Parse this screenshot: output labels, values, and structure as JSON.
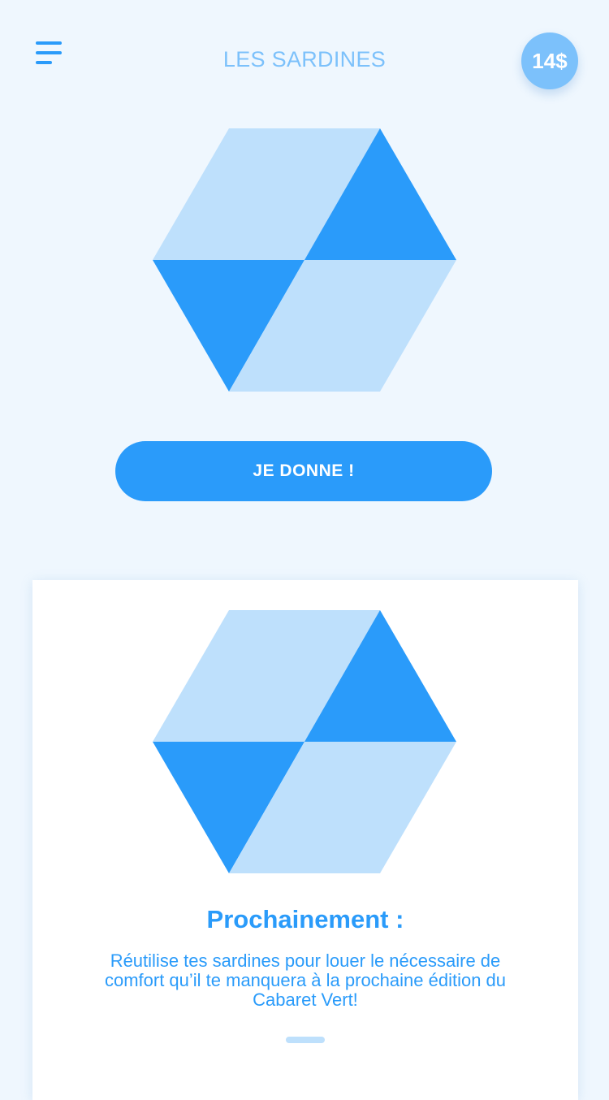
{
  "header": {
    "title": "LES SARDINES",
    "balance": "14$",
    "menu_icon": "hamburger-menu-icon"
  },
  "hero": {
    "logo_icon": "hexagon-cube-logo-icon",
    "cta_label": "JE DONNE !"
  },
  "card": {
    "logo_icon": "hexagon-cube-logo-icon",
    "title": "Prochainement :",
    "description": "Réutilise tes sardines pour louer le nécessaire de comfort qu’il te manquera à la prochaine édition du Cabaret Vert!"
  },
  "colors": {
    "background": "#EFF7FE",
    "primary": "#2A9BFA",
    "light": "#BEE0FC",
    "badge": "#7CC1FB",
    "card": "#FFFFFF"
  }
}
